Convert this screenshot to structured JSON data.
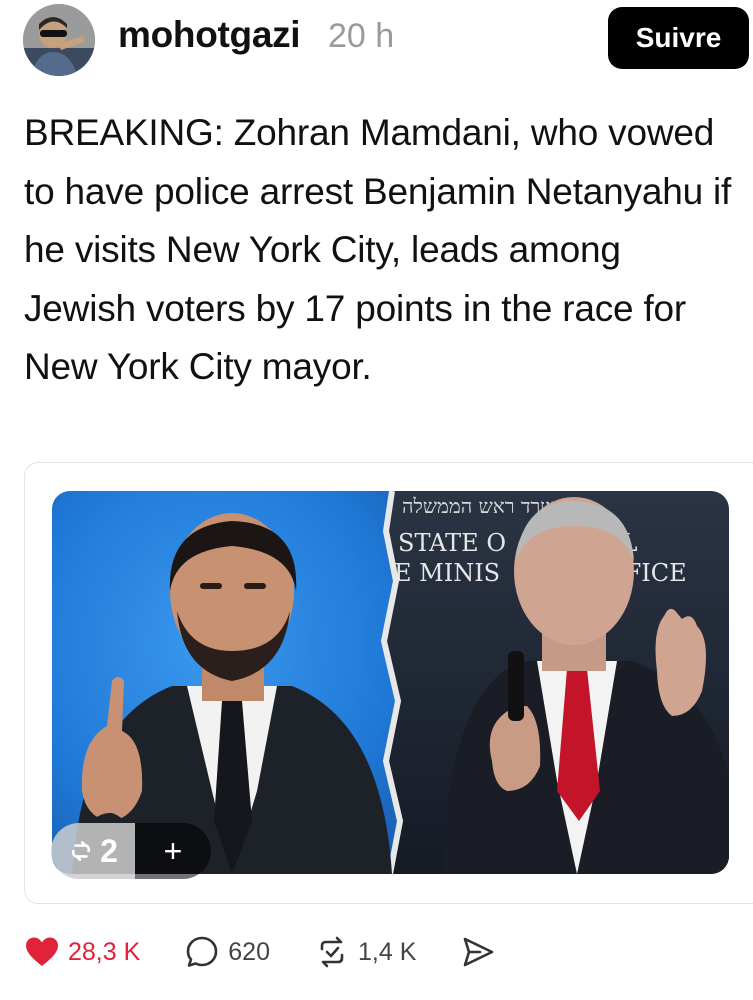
{
  "header": {
    "username": "mohotgazi",
    "timestamp": "20 h",
    "follow_label": "Suivre"
  },
  "post": {
    "text": "BREAKING: Zohran Mamdani, who vowed to have police arrest Benjamin Netanyahu if he visits New York City, leads among Jewish voters by 17 points in the race for New York City mayor."
  },
  "image_overlay": {
    "repost_count": "2",
    "add_label": "+"
  },
  "image_sign": {
    "hebrew": "משרד ראש הממשלה",
    "line1": "STATE O",
    "line1b": "EL",
    "line2": "E MINIS",
    "line2b": "FFICE"
  },
  "actions": {
    "likes": "28,3 K",
    "comments": "620",
    "reposts": "1,4 K"
  },
  "colors": {
    "like": "#e0233a",
    "follow_bg": "#000000",
    "left_panel_bg": "#1f78d6",
    "right_panel_bg": "#1b2433"
  },
  "icons": [
    "heart-icon",
    "comment-icon",
    "repost-icon",
    "share-icon"
  ]
}
